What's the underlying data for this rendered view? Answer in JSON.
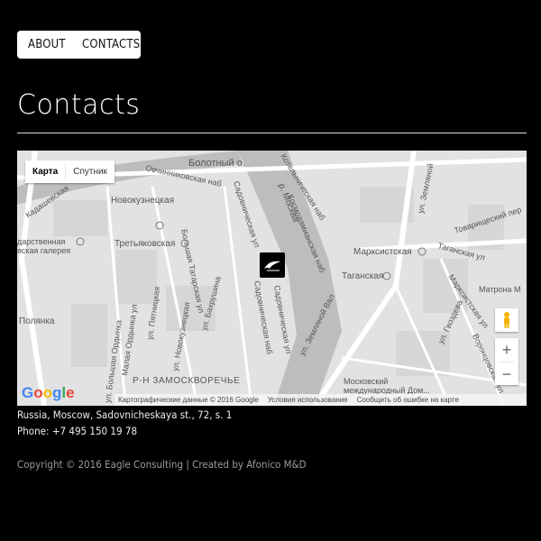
{
  "nav": {
    "about": "ABOUT",
    "contacts": "CONTACTS"
  },
  "page": {
    "title": "Contacts"
  },
  "map": {
    "type_options": {
      "map": "Карта",
      "satellite": "Спутник"
    },
    "zoom_in": "+",
    "zoom_out": "−",
    "logo": {
      "G1": "G",
      "o1": "o",
      "o2": "o",
      "g": "g",
      "l": "l",
      "e": "e"
    },
    "attribution": {
      "data": "Картографические данные © 2016 Google",
      "terms": "Условия использования",
      "report": "Сообщить об ошибке на карте"
    },
    "labels": {
      "bolotny": "Болотный о.",
      "ovchinnikovskaya": "Овчинниковская наб",
      "kotelnicheskaya": "Котельническая наб",
      "zemlyanoy": "ул. Земляной",
      "kadashevskaya": "Кадашевская",
      "novokuznetskaya": "Новокузнецкая",
      "gallery1": "дарственная",
      "gallery2": "яская галерея",
      "tretyakovskaya": "Третьяковская",
      "sadovnicheskaya": "Садовническая ул",
      "moskva_river": "р. Москва",
      "kosmodamianskaya": "Космодамианская наб",
      "marksistskaya": "Марксистская",
      "taganskaya_ul": "Таганская ул",
      "taganskaya": "Таганская",
      "tovarishchesky": "Товарищеский пер",
      "polyanka": "Полянка",
      "bolshaya_ordynka": "ул. Большая Ордынка",
      "malaya_ordynka": "Малая Ордынка ул",
      "pyatnitskaya": "ул. Пятницкая",
      "novokuznetskaya_ul": "ул. Новокузнецкая",
      "tatarskaya": "Большая Татарская ул",
      "bakhrushina": "ул. Бахрушина",
      "sadovnicheskaya_nab": "Садовническая наб",
      "sadovnicheskaya_ul2": "Садовническая ул",
      "zemlyanoy_val": "ул. Земляной Вал",
      "matrona": "Матрона М",
      "gvozdeva": "ул. Гвоздева",
      "vorontsovskaya": "Воронцовская ул",
      "marksistskaya_ul": "Марксистская ул",
      "zamoskvorechye": "Р-Н ЗАМОСКВОРЕЧЬЕ",
      "mmdm1": "Московский",
      "mmdm2": "международный Дом..."
    }
  },
  "contact": {
    "address": "Russia, Moscow, Sadovnicheskaya st., 72, s. 1",
    "phone": "Phone: +7 495 150 19 78"
  },
  "footer": {
    "copyright": "Copyright © 2016 Eagle Consulting | Created by Afonico M&D"
  },
  "colors": {
    "background": "#000000",
    "map_land": "#e2e2e2",
    "map_water": "#bdbdbd",
    "google_blue": "#4285f4",
    "google_red": "#ea4335",
    "google_yellow": "#fbbc05",
    "google_green": "#34a853",
    "pegman": "#f4b400"
  },
  "icons": {
    "marker": "eagle-logo-marker-icon",
    "pegman": "street-view-pegman-icon",
    "metro": "metro-station-icon"
  }
}
